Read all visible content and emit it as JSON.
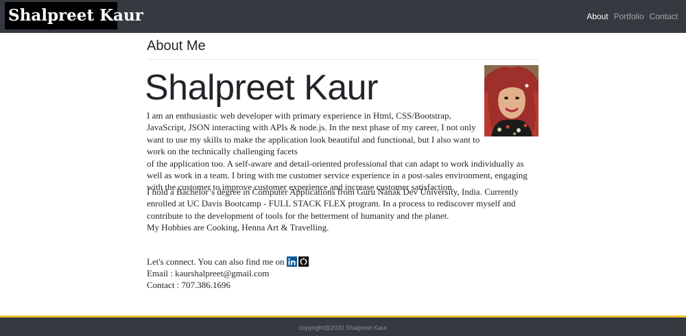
{
  "navbar": {
    "brand": "Shalpreet Kaur",
    "links": [
      {
        "label": "About",
        "active": true
      },
      {
        "label": "Portfolio",
        "active": false
      },
      {
        "label": "Contact",
        "active": false
      }
    ]
  },
  "main": {
    "section_title": "About Me",
    "name": "Shalpreet Kaur",
    "paragraphs": {
      "p1_part1": "I am an enthusiastic web developer with primary experience in Html, CSS/Bootstrap, JavaScript, JSON interacting with APIs & node.js. In the next phase of my career, I not only want to use my skills to make the application look beautiful and functional, but I also want to work on the technically challenging facets",
      "p1_part2": "of the application too. A self-aware and detail-oriented professional that can adapt to work individually as well as work in a team. I bring with me customer service experience in a post-sales environment, engaging with the customer to improve customer experience and increase customer satisfaction.",
      "p2": "I hold a Bachelor’s degree in Computer Applications from Guru Nanak Dev University, India. Currently enrolled at UC Davis Bootcamp - FULL STACK FLEX program. In a process to rediscover myself and contribute to the development of tools for the betterment of humanity and the planet.",
      "hobbies": "My Hobbies are Cooking, Henna Art & Travelling."
    },
    "connect": {
      "text": "Let's connect. You can also find me on",
      "email": "Email : kaurshalpreet@gmail.com",
      "contact": "Contact : 707.386.1696"
    }
  },
  "footer": {
    "text": "copyright@2020 Shalpreet Kaur"
  },
  "colors": {
    "navbar_bg": "#343a40",
    "brand_bg": "#000000",
    "footer_accent": "#f2c12e",
    "linkedin_blue": "#0e5a97"
  },
  "icons": [
    "linkedin-icon",
    "github-icon"
  ]
}
